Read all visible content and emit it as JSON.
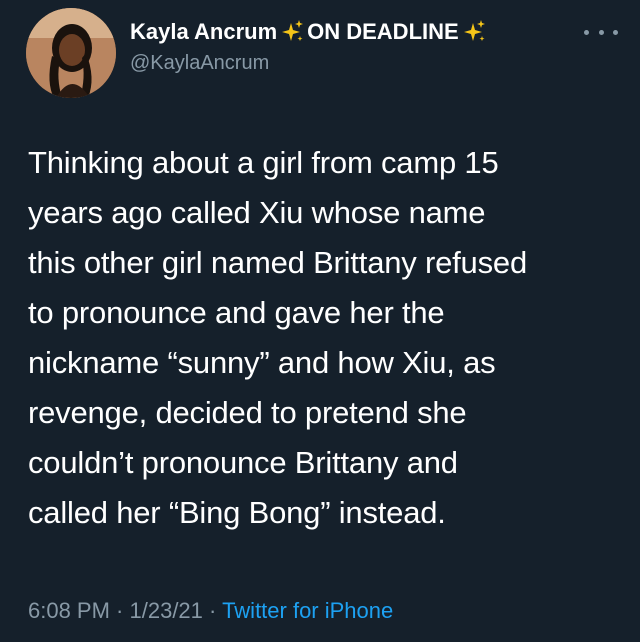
{
  "author": {
    "display_name": "Kayla Ancrum",
    "display_suffix": "ON DEADLINE",
    "handle": "@KaylaAncrum",
    "sparkle_icon": "sparkles-icon",
    "avatar_icon": "profile-photo"
  },
  "tweet": {
    "lines": [
      "Thinking about a girl from camp 15",
      "years ago called Xiu whose name",
      "this other girl named Brittany refused",
      "to pronounce and gave her the",
      "nickname “sunny” and how Xiu, as",
      "revenge, decided to pretend she",
      "couldn’t pronounce Brittany and",
      "called her “Bing Bong” instead."
    ]
  },
  "meta": {
    "time": "6:08 PM",
    "separator": " · ",
    "date": "1/23/21",
    "source": "Twitter for iPhone"
  },
  "colors": {
    "background": "#15202b",
    "text": "#ffffff",
    "secondary": "#8899a6",
    "link": "#1da1f2",
    "sparkle": "#f5c518"
  }
}
